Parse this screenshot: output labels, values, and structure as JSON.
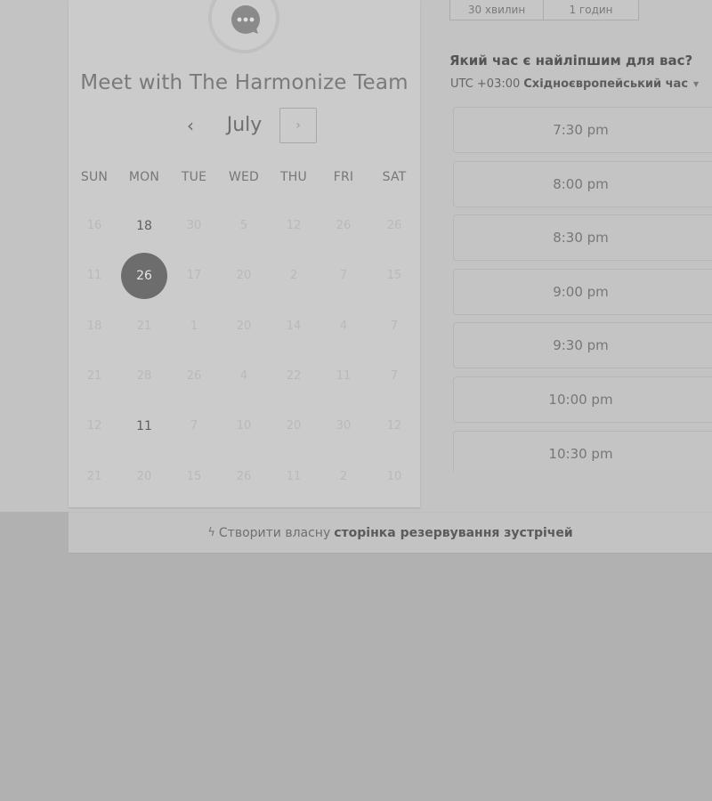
{
  "card": {
    "title": "Meet with The Harmonize Team",
    "month": "July",
    "prev_symbol": "‹",
    "next_symbol": "›",
    "avatar_icon": "chat-bubble-icon"
  },
  "weekdays": [
    "SUN",
    "MON",
    "TUE",
    "WED",
    "THU",
    "FRI",
    "SAT"
  ],
  "days": [
    {
      "label": "16",
      "state": "disabled"
    },
    {
      "label": "18",
      "state": "available"
    },
    {
      "label": "30",
      "state": "disabled"
    },
    {
      "label": "5",
      "state": "disabled"
    },
    {
      "label": "12",
      "state": "disabled"
    },
    {
      "label": "26",
      "state": "disabled"
    },
    {
      "label": "26",
      "state": "disabled"
    },
    {
      "label": "11",
      "state": "disabled"
    },
    {
      "label": "26",
      "state": "selected"
    },
    {
      "label": "17",
      "state": "disabled"
    },
    {
      "label": "20",
      "state": "disabled"
    },
    {
      "label": "2",
      "state": "disabled"
    },
    {
      "label": "7",
      "state": "disabled"
    },
    {
      "label": "15",
      "state": "disabled"
    },
    {
      "label": "18",
      "state": "disabled"
    },
    {
      "label": "21",
      "state": "disabled"
    },
    {
      "label": "1",
      "state": "disabled"
    },
    {
      "label": "20",
      "state": "disabled"
    },
    {
      "label": "14",
      "state": "disabled"
    },
    {
      "label": "4",
      "state": "disabled"
    },
    {
      "label": "7",
      "state": "disabled"
    },
    {
      "label": "21",
      "state": "disabled"
    },
    {
      "label": "28",
      "state": "disabled"
    },
    {
      "label": "26",
      "state": "disabled"
    },
    {
      "label": "4",
      "state": "disabled"
    },
    {
      "label": "22",
      "state": "disabled"
    },
    {
      "label": "11",
      "state": "disabled"
    },
    {
      "label": "7",
      "state": "disabled"
    },
    {
      "label": "12",
      "state": "disabled"
    },
    {
      "label": "11",
      "state": "available"
    },
    {
      "label": "7",
      "state": "disabled"
    },
    {
      "label": "10",
      "state": "disabled"
    },
    {
      "label": "20",
      "state": "disabled"
    },
    {
      "label": "30",
      "state": "disabled"
    },
    {
      "label": "12",
      "state": "disabled"
    },
    {
      "label": "21",
      "state": "disabled"
    },
    {
      "label": "20",
      "state": "disabled"
    },
    {
      "label": "15",
      "state": "disabled"
    },
    {
      "label": "26",
      "state": "disabled"
    },
    {
      "label": "11",
      "state": "disabled"
    },
    {
      "label": "2",
      "state": "disabled"
    },
    {
      "label": "10",
      "state": "disabled"
    }
  ],
  "durations": [
    {
      "label": "30 хвилин"
    },
    {
      "label": "1 годин"
    }
  ],
  "question": "Який час є найліпшим для вас?",
  "timezone": {
    "offset": "UTC +03:00",
    "name": "Східноєвропейський час",
    "caret": "▼"
  },
  "slots": [
    "7:30 pm",
    "8:00 pm",
    "8:30 pm",
    "9:00 pm",
    "9:30 pm",
    "10:00 pm",
    "10:30 pm"
  ],
  "footer": {
    "icon": "hubspot-sprocket-icon",
    "icon_glyph": "ϟ",
    "text": "Створити власну",
    "bold": "сторінка резервування зустрічей"
  }
}
